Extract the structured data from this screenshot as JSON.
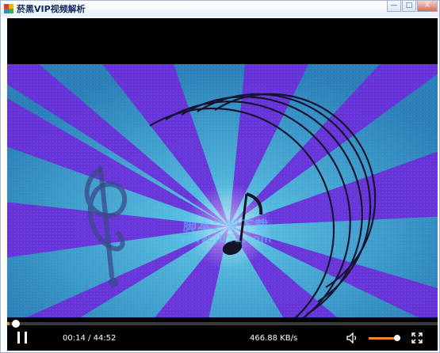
{
  "window": {
    "title": "菸黑VIP视频解析",
    "controls": {
      "minimize_glyph": "—",
      "maximize_glyph": "□",
      "close_glyph": "X"
    }
  },
  "player": {
    "current_time": "00:14",
    "time_separator": "/",
    "total_time": "44:52",
    "speed": "466.88 KB/s",
    "progress": 0.0052,
    "volume": 0.9,
    "accent_color": "#f08a24"
  },
  "watermark": {
    "line1": "脚本之家下载",
    "line2": "www.jb51.com"
  },
  "icons": {
    "pause": "pause-icon",
    "volume": "speaker-icon",
    "fullscreen": "fullscreen-icon",
    "app": "app-icon"
  }
}
